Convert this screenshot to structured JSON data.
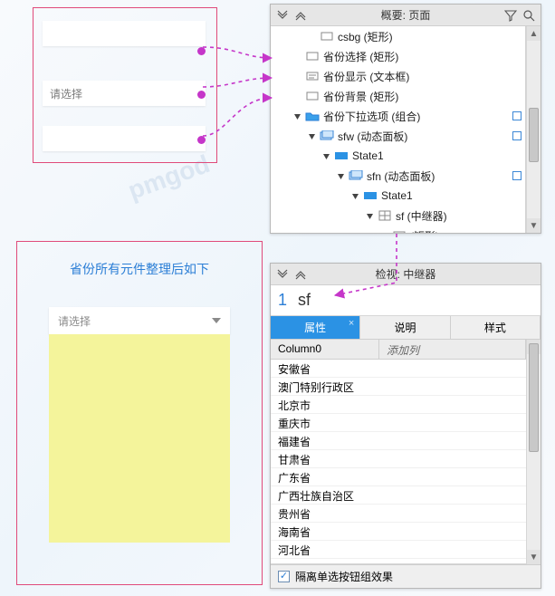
{
  "watermark": "pmgod",
  "upper_demo": {
    "placeholder": "请选择"
  },
  "lower_demo": {
    "title": "省份所有元件整理后如下",
    "placeholder": "请选择"
  },
  "outline": {
    "title": "概要: 页面",
    "rows": [
      {
        "depth": 2,
        "toggle": "none",
        "icon": "rect",
        "label": "csbg (矩形)",
        "sel": null
      },
      {
        "depth": 1,
        "toggle": "none",
        "icon": "rect",
        "label": "省份选择 (矩形)",
        "sel": null
      },
      {
        "depth": 1,
        "toggle": "none",
        "icon": "text",
        "label": "省份显示 (文本框)",
        "sel": null
      },
      {
        "depth": 1,
        "toggle": "none",
        "icon": "rect",
        "label": "省份背景 (矩形)",
        "sel": null
      },
      {
        "depth": 1,
        "toggle": "open",
        "icon": "folder",
        "label": "省份下拉选项 (组合)",
        "sel": "open"
      },
      {
        "depth": 2,
        "toggle": "open",
        "icon": "dyn",
        "label": "sfw (动态面板)",
        "sel": "open"
      },
      {
        "depth": 3,
        "toggle": "open",
        "icon": "state",
        "label": "State1",
        "sel": null
      },
      {
        "depth": 4,
        "toggle": "open",
        "icon": "dyn",
        "label": "sfn (动态面板)",
        "sel": "open"
      },
      {
        "depth": 5,
        "toggle": "open",
        "icon": "state",
        "label": "State1",
        "sel": null
      },
      {
        "depth": 6,
        "toggle": "open",
        "icon": "rep",
        "label": "sf (中继器)",
        "sel": null
      },
      {
        "depth": 7,
        "toggle": "none",
        "icon": "rect",
        "label": "(矩形)",
        "sel": null
      }
    ]
  },
  "inspector": {
    "title": "检视: 中继器",
    "index": "1",
    "name": "sf",
    "tabs": {
      "props": "属性",
      "notes": "说明",
      "style": "样式"
    },
    "columns": {
      "col0": "Column0",
      "add": "添加列"
    },
    "rows": [
      "安徽省",
      "澳门特别行政区",
      "北京市",
      "重庆市",
      "福建省",
      "甘肃省",
      "广东省",
      "广西壮族自治区",
      "贵州省",
      "海南省",
      "河北省"
    ],
    "footer_opt": "隔离单选按钮组效果",
    "footer_checked": true
  }
}
